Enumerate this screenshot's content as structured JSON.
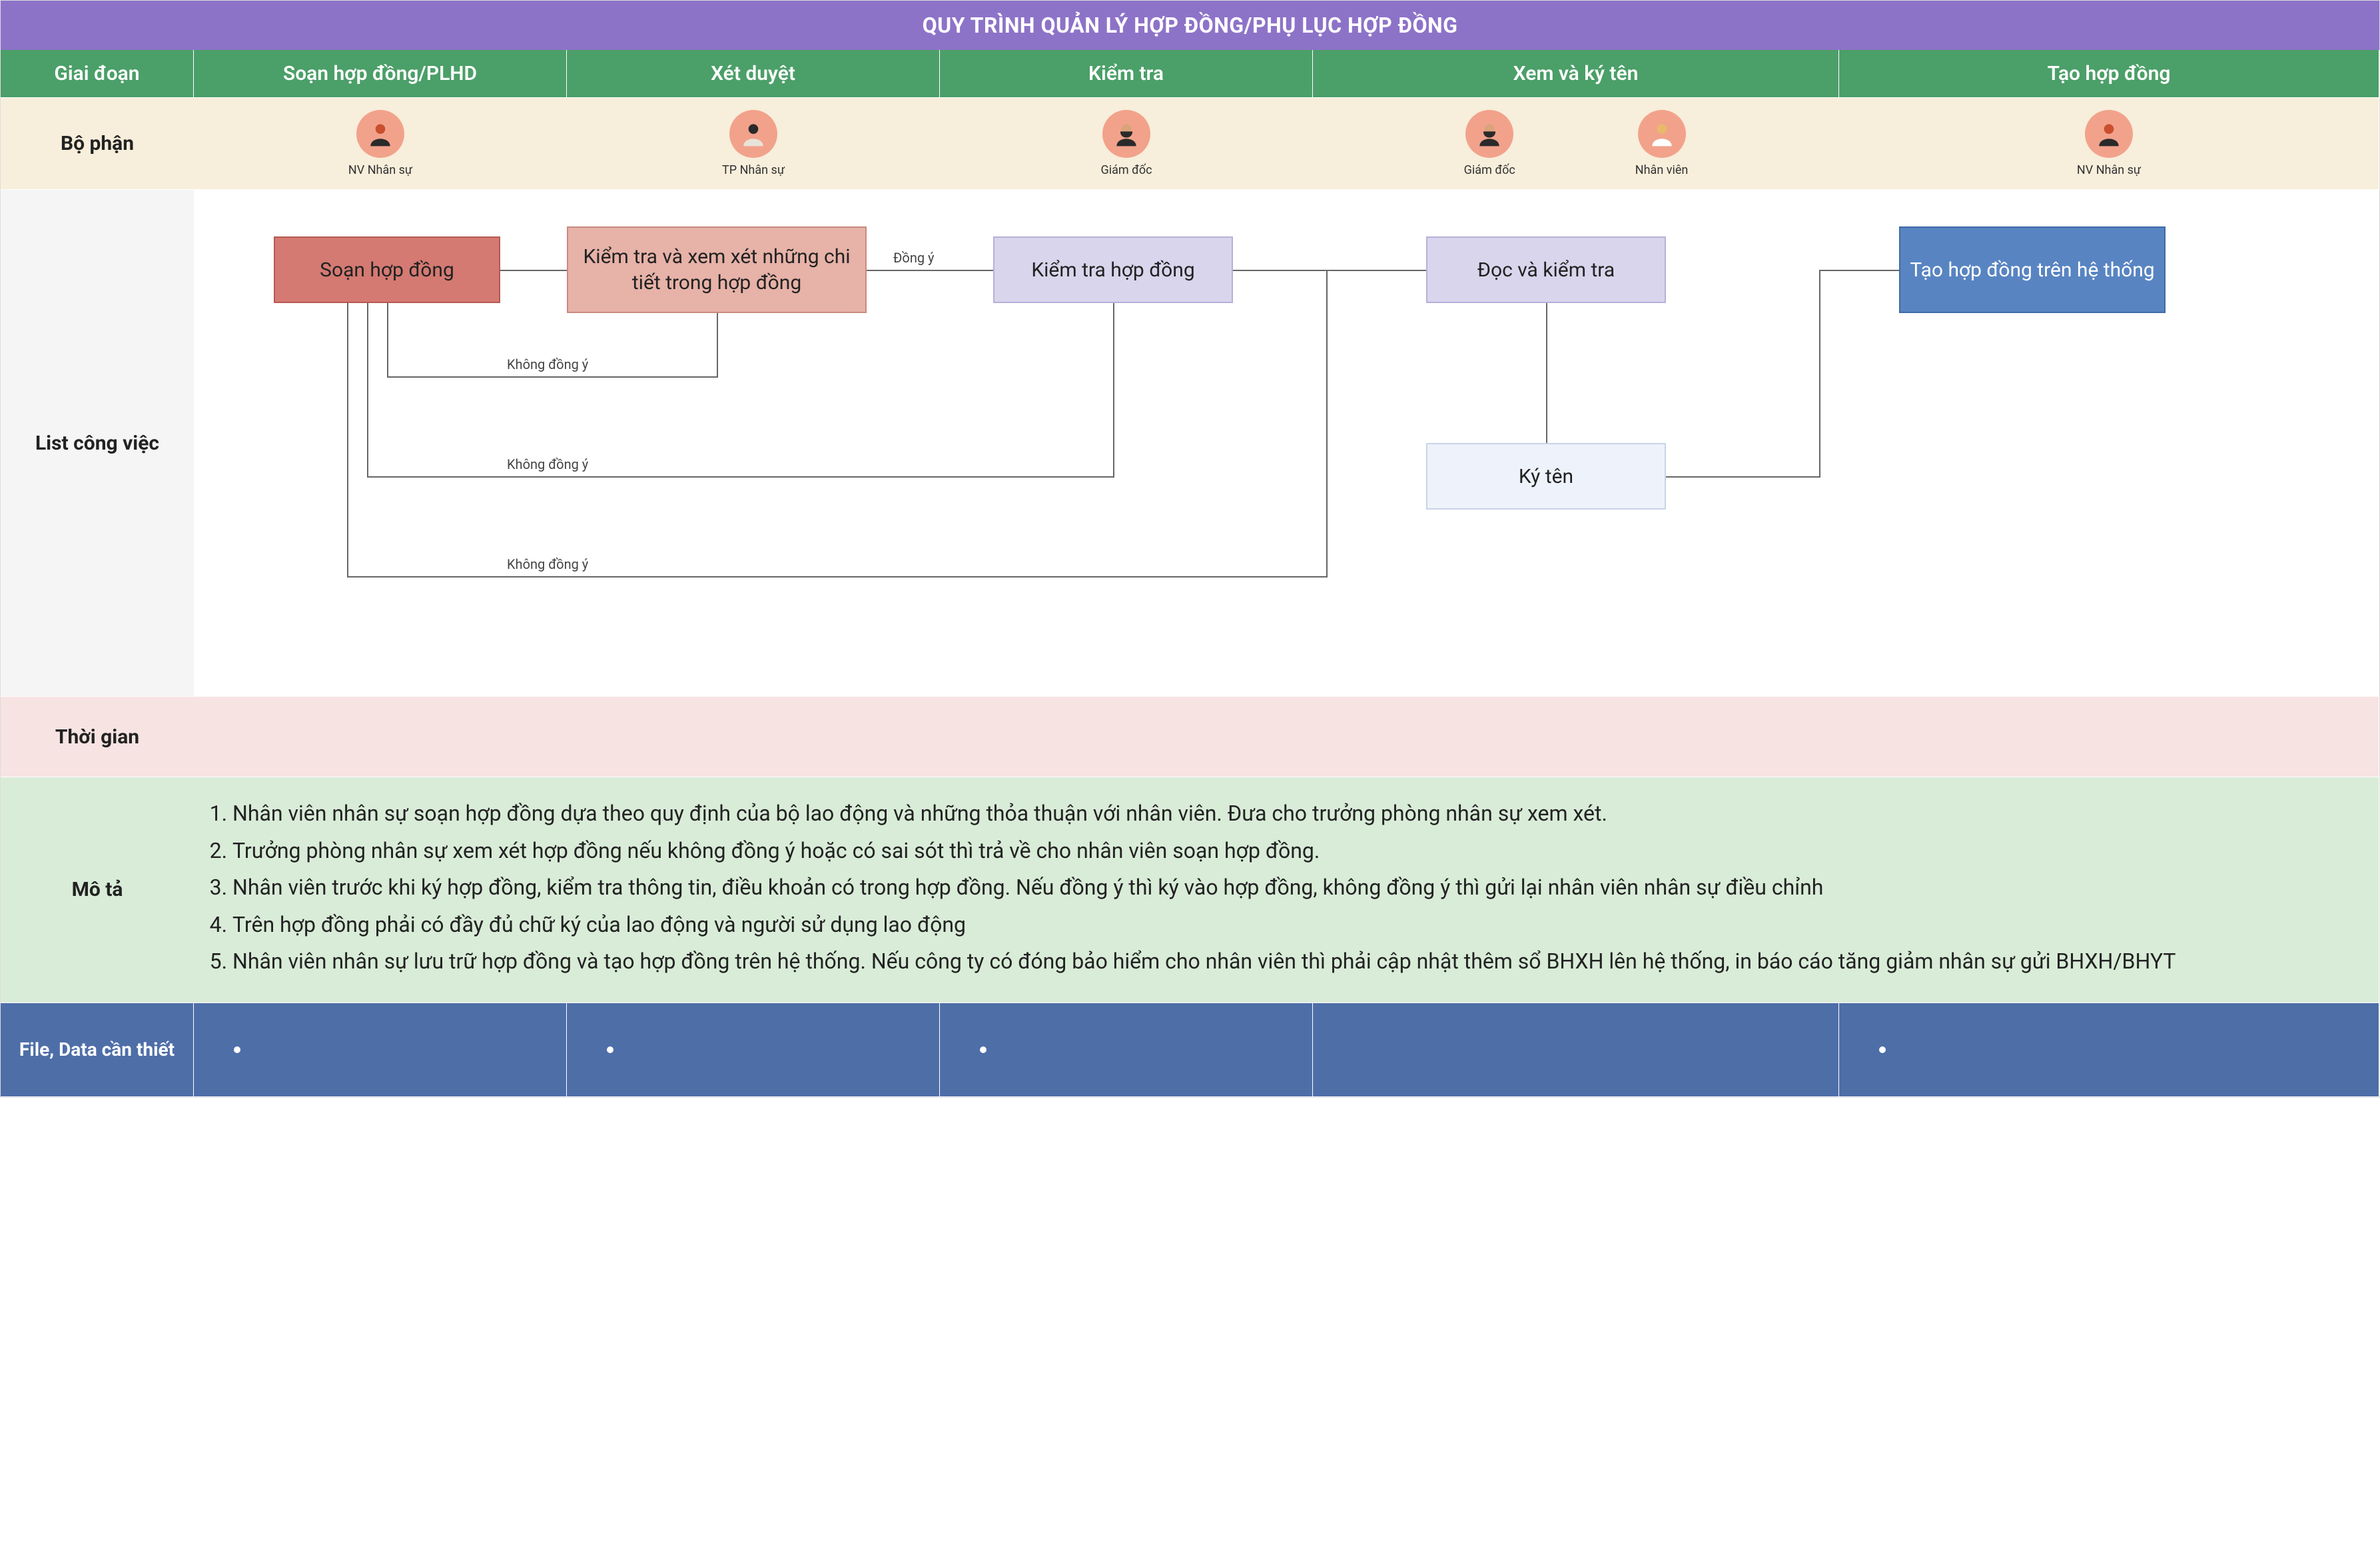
{
  "title": "QUY TRÌNH QUẢN LÝ HỢP ĐỒNG/PHỤ LỤC HỢP ĐỒNG",
  "headers": {
    "stage": "Giai đoạn",
    "c1": "Soạn hợp đồng/PLHD",
    "c2": "Xét duyệt",
    "c3": "Kiểm tra",
    "c4": "Xem và ký tên",
    "c5": "Tạo hợp đồng"
  },
  "rows": {
    "dept": "Bộ phận",
    "work": "List công việc",
    "time": "Thời gian",
    "desc": "Mô tả",
    "file": "File, Data cần thiết"
  },
  "personas": {
    "p1": "NV Nhân sự",
    "p2": "TP Nhân sự",
    "p3": "Giám đốc",
    "p4a": "Giám đốc",
    "p4b": "Nhân viên",
    "p5": "NV Nhân sự"
  },
  "boxes": {
    "b1": "Soạn hợp đồng",
    "b2": "Kiểm tra và xem xét những chi tiết trong hợp đồng",
    "b3": "Kiểm tra hợp đồng",
    "b4": "Đọc và kiểm tra",
    "b5": "Ký tên",
    "b6": "Tạo hợp đồng trên hệ thống"
  },
  "edges": {
    "agree": "Đồng ý",
    "disagree": "Không đồng ý"
  },
  "desc_items": {
    "d1": "Nhân viên nhân sự soạn hợp đồng dựa theo quy định của bộ lao động và những thỏa thuận với nhân viên. Đưa cho trưởng phòng nhân sự xem xét.",
    "d2": "Trưởng phòng nhân sự xem xét hợp đồng nếu không đồng ý hoặc có sai sót thì trả về cho nhân viên soạn hợp đồng.",
    "d3": "Nhân viên trước khi ký hợp đồng, kiểm tra thông tin, điều khoản có trong hợp đồng. Nếu đồng ý thì ký vào hợp đồng, không đồng ý thì gửi lại nhân viên nhân sự điều chỉnh",
    "d4": "Trên hợp đồng phải có đầy đủ chữ ký của lao động và người sử dụng lao động",
    "d5": "Nhân viên nhân sự lưu trữ hợp đồng và tạo hợp đồng trên hệ thống. Nếu công ty có đóng bảo hiểm cho nhân viên thì phải cập nhật thêm sổ BHXH lên hệ thống, in báo cáo tăng giảm nhân sự gửi BHXH/BHYT"
  }
}
